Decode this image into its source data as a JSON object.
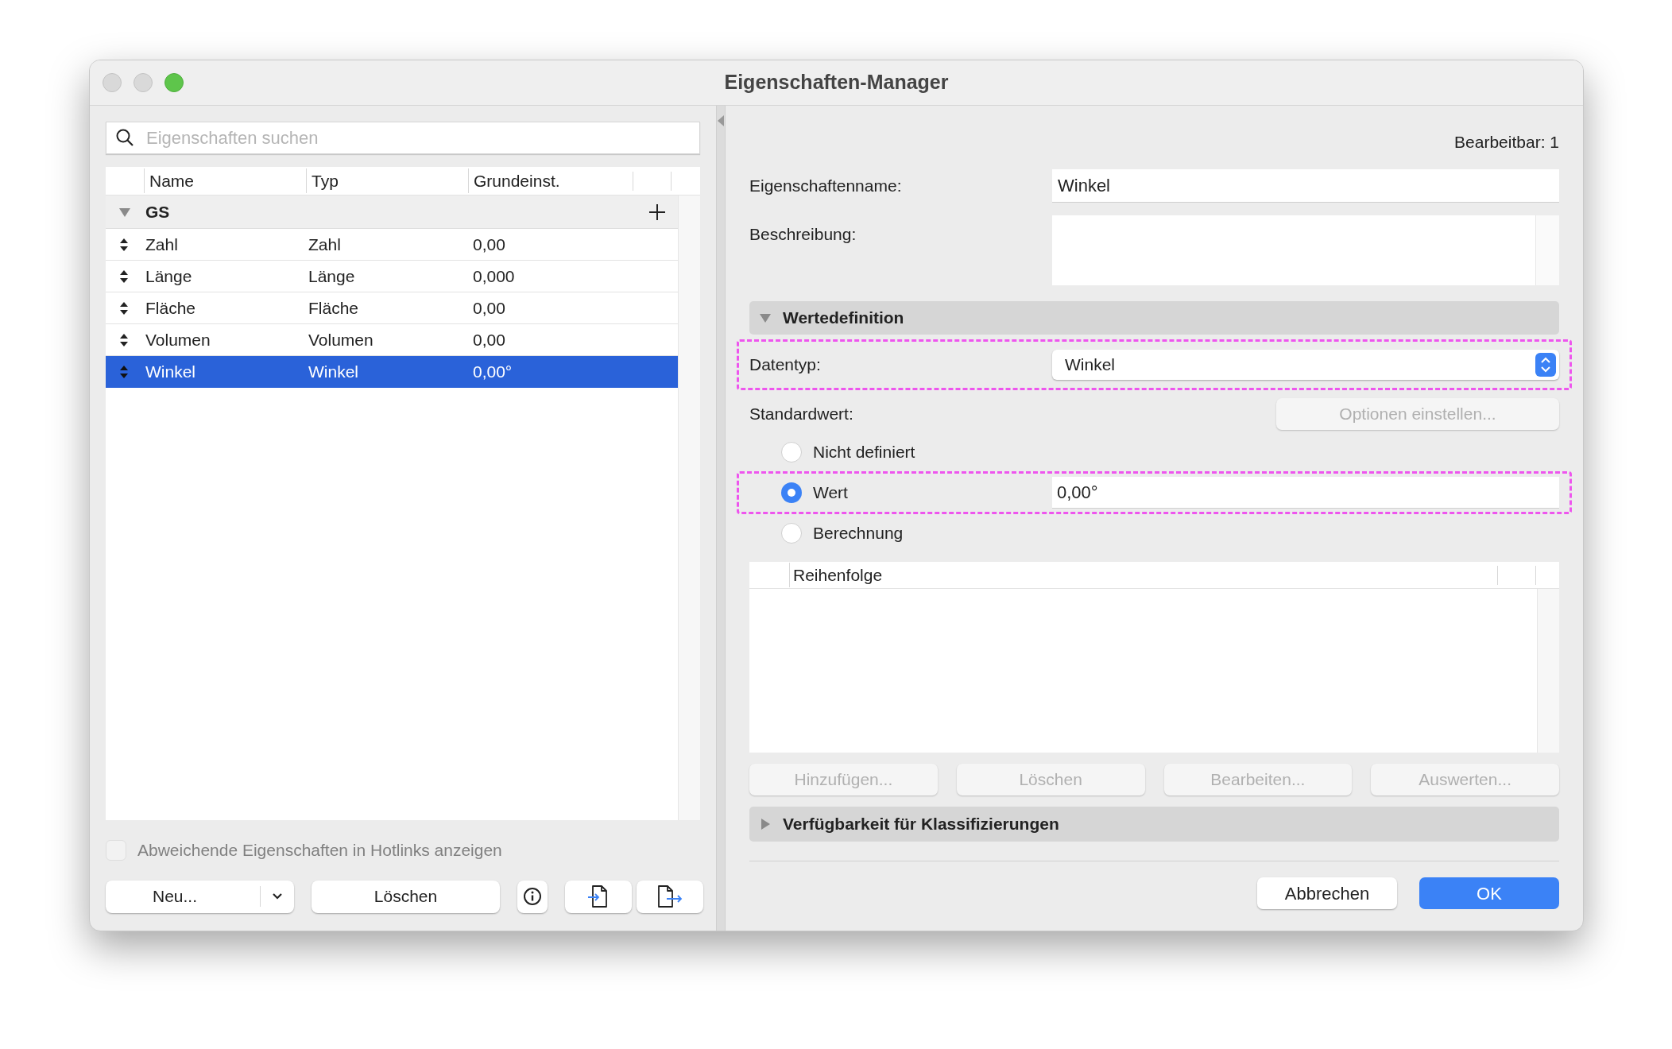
{
  "window": {
    "title": "Eigenschaften-Manager"
  },
  "search": {
    "placeholder": "Eigenschaften suchen"
  },
  "table": {
    "columns": [
      "Name",
      "Typ",
      "Grundeinst."
    ],
    "groups": [
      {
        "name": "GS",
        "expanded": true,
        "rows": [
          {
            "name": "Zahl",
            "type": "Zahl",
            "default": "0,00",
            "selected": false
          },
          {
            "name": "Länge",
            "type": "Länge",
            "default": "0,000",
            "selected": false
          },
          {
            "name": "Fläche",
            "type": "Fläche",
            "default": "0,00",
            "selected": false
          },
          {
            "name": "Volumen",
            "type": "Volumen",
            "default": "0,00",
            "selected": false
          },
          {
            "name": "Winkel",
            "type": "Winkel",
            "default": "0,00°",
            "selected": true
          }
        ]
      }
    ]
  },
  "hotlinks_checkbox": {
    "label": "Abweichende Eigenschaften in Hotlinks anzeigen",
    "checked": false,
    "disabled": true
  },
  "left_buttons": [
    {
      "kind": "split",
      "label": "Neu..."
    },
    {
      "kind": "text",
      "label": "Löschen"
    },
    {
      "kind": "info"
    },
    {
      "kind": "import"
    },
    {
      "kind": "export"
    }
  ],
  "editable_count": "Bearbeitbar: 1",
  "name_field": {
    "label": "Eigenschaftenname:",
    "value": "Winkel"
  },
  "description_field": {
    "label": "Beschreibung:"
  },
  "value_definition": {
    "title": "Wertedefinition",
    "expanded": true
  },
  "datatype": {
    "label": "Datentyp:",
    "value": "Winkel",
    "highlighted": true
  },
  "default_value": {
    "label": "Standardwert:",
    "options_button": {
      "label": "Optionen einstellen...",
      "disabled": true
    },
    "radios": [
      {
        "label": "Nicht definiert",
        "selected": false,
        "highlighted": false
      },
      {
        "label": "Wert",
        "selected": true,
        "value": "0,00°",
        "highlighted": true
      },
      {
        "label": "Berechnung",
        "selected": false,
        "highlighted": false
      }
    ]
  },
  "order_table": {
    "columns": [
      "Reihenfolge"
    ]
  },
  "order_buttons": [
    {
      "label": "Hinzufügen...",
      "disabled": true
    },
    {
      "label": "Löschen",
      "disabled": true
    },
    {
      "label": "Bearbeiten...",
      "disabled": true
    },
    {
      "label": "Auswerten...",
      "disabled": true
    }
  ],
  "availability": {
    "title": "Verfügbarkeit für Klassifizierungen",
    "expanded": false
  },
  "dialog_buttons": [
    {
      "label": "Abbrechen",
      "primary": false
    },
    {
      "label": "OK",
      "primary": true
    }
  ]
}
